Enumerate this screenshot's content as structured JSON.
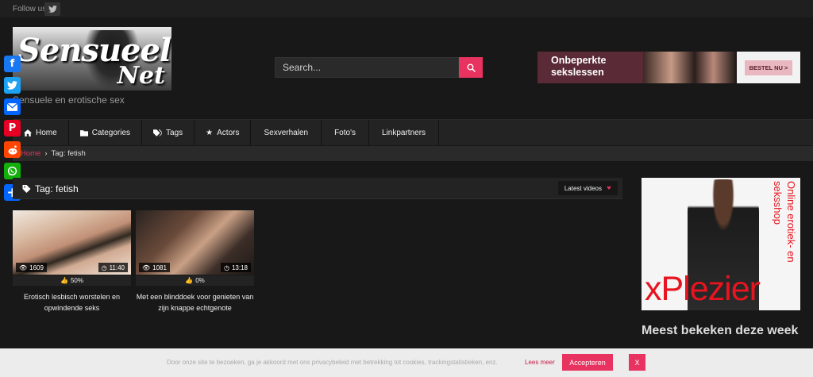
{
  "topbar": {
    "follow_label": "Follow us:",
    "social_icon": "twitter-icon"
  },
  "logo": {
    "line1": "Sensueel",
    "line2": "Net"
  },
  "tagline": "Sensuele en erotische sex",
  "search": {
    "placeholder": "Search...",
    "icon": "search-icon"
  },
  "banner": {
    "text": "Onbeperkte sekslessen",
    "button": "BESTEL NU >"
  },
  "nav": {
    "items": [
      {
        "label": "Home",
        "icon": "home-icon"
      },
      {
        "label": "Categories",
        "icon": "folder-icon"
      },
      {
        "label": "Tags",
        "icon": "tag-icon"
      },
      {
        "label": "Actors",
        "icon": "star-icon"
      },
      {
        "label": "Sexverhalen",
        "icon": ""
      },
      {
        "label": "Foto's",
        "icon": ""
      },
      {
        "label": "Linkpartners",
        "icon": ""
      }
    ]
  },
  "breadcrumb": {
    "home": "Home",
    "separator": "›",
    "current": "Tag: fetish"
  },
  "share": {
    "items": [
      {
        "name": "facebook",
        "color": "#1877f2",
        "glyph": "f"
      },
      {
        "name": "twitter",
        "color": "#1da1f2",
        "glyph": "t"
      },
      {
        "name": "email",
        "color": "#0166ff",
        "glyph": "✉"
      },
      {
        "name": "pinterest",
        "color": "#e60023",
        "glyph": "P"
      },
      {
        "name": "reddit",
        "color": "#ff4500",
        "glyph": "r"
      },
      {
        "name": "whatsapp",
        "color": "#12af0a",
        "glyph": "✆"
      },
      {
        "name": "share",
        "color": "#0166ff",
        "glyph": "+"
      }
    ]
  },
  "main": {
    "title": "Tag: fetish",
    "sort_label": "Latest videos",
    "videos": [
      {
        "views": "1609",
        "duration": "11:40",
        "rating": "50%",
        "title": "Erotisch lesbisch worstelen en opwindende seks"
      },
      {
        "views": "1081",
        "duration": "13:18",
        "rating": "0%",
        "title": "Met een blinddoek voor genieten van zijn knappe echtgenote"
      }
    ]
  },
  "sidebar": {
    "ad_vertical": "Online erotiek- en seksshop",
    "ad_brand": "xPlezier",
    "heading": "Meest bekeken deze week"
  },
  "cookie": {
    "text": "Door onze site te bezoeken, ga je akkoord met ons privacybeleid met betrekking tot cookies, trackingstatistieken, enz.",
    "more": "Lees meer",
    "accept": "Accepteren",
    "close": "X"
  },
  "colors": {
    "accent": "#e8325f",
    "background": "#181818",
    "bar": "#232323"
  }
}
